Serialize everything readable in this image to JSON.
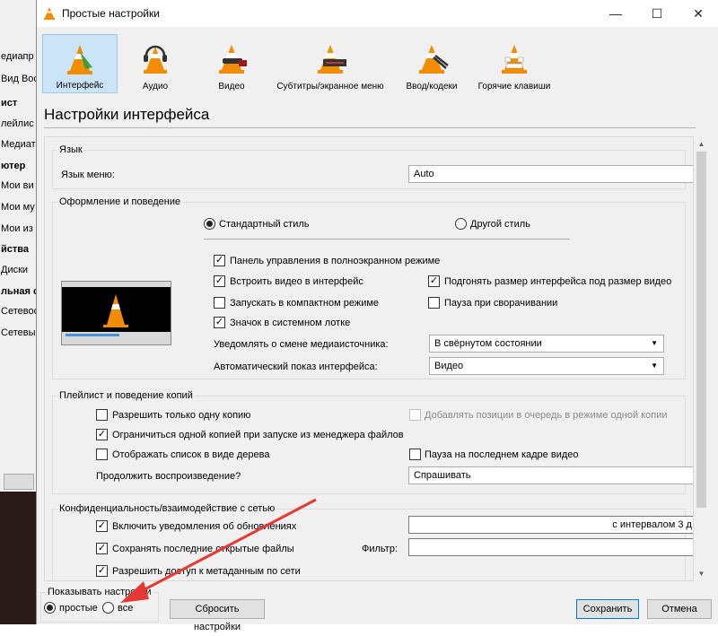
{
  "background_window": {
    "items": [
      {
        "label": "едиапр",
        "bold": false
      },
      {
        "label": "Вид  Вос",
        "bold": false
      },
      {
        "label": "ист",
        "bold": true
      },
      {
        "label": "лейлис",
        "bold": false
      },
      {
        "label": "Медиате",
        "bold": false
      },
      {
        "label": "ютер",
        "bold": true
      },
      {
        "label": "Мои ви",
        "bold": false
      },
      {
        "label": "Мои му",
        "bold": false
      },
      {
        "label": "Мои из",
        "bold": false
      },
      {
        "label": "йства",
        "bold": true
      },
      {
        "label": "Диски",
        "bold": false
      },
      {
        "label": "льная се",
        "bold": true
      },
      {
        "label": "Сетевос",
        "bold": false
      },
      {
        "label": "Сетевы",
        "bold": false
      }
    ]
  },
  "window": {
    "title": "Простые настройки",
    "minimize": "—",
    "maximize": "☐",
    "close": "✕",
    "bg_close": "✕"
  },
  "toolbar": [
    {
      "label": "Интерфейс",
      "selected": true
    },
    {
      "label": "Аудио",
      "selected": false
    },
    {
      "label": "Видео",
      "selected": false
    },
    {
      "label": "Субтитры/экранное меню",
      "selected": false
    },
    {
      "label": "Ввод/кодеки",
      "selected": false
    },
    {
      "label": "Горячие клавиши",
      "selected": false
    }
  ],
  "page_title": "Настройки интерфейса",
  "language": {
    "group": "Язык",
    "menu_label": "Язык меню:",
    "menu_value": "Auto"
  },
  "look": {
    "group": "Оформление и поведение",
    "style_native": "Стандартный стиль",
    "style_other": "Другой стиль",
    "fullscreen_controller": "Панель управления в полноэкранном режиме",
    "embed_video": "Встроить видео в интерфейс",
    "resize_interface": "Подгонять размер интерфейса под размер видео",
    "start_minimal": "Запускать в компактном режиме",
    "pause_minimized": "Пауза при сворачивании",
    "systray": "Значок в системном лотке",
    "notify_label": "Уведомлять о смене медиаисточника:",
    "notify_value": "В свёрнутом состоянии",
    "autoraise_label": "Автоматический показ интерфейса:",
    "autoraise_value": "Видео"
  },
  "playlist": {
    "group": "Плейлист и поведение копий",
    "one_instance": "Разрешить только одну копию",
    "enqueue": "Добавлять позиции в очередь в режиме одной копии",
    "file_manager": "Ограничиться одной копией при запуске из менеджера файлов",
    "tree": "Отображать список в виде дерева",
    "pause_last": "Пауза на последнем кадре видео",
    "resume_label": "Продолжить воспроизведение?",
    "resume_value": "Спрашивать"
  },
  "privacy": {
    "group": "Конфиденциальность/взаимодействие с сетью",
    "updates": "Включить уведомления об обновлениях",
    "updates_interval": "с интервалом 3 д.",
    "recent": "Сохранять последние открытые файлы",
    "filter_label": "Фильтр:",
    "metadata": "Разрешить доступ к метаданным по сети"
  },
  "show_settings": {
    "label": "Показывать настройки",
    "simple": "простые",
    "all": "все"
  },
  "buttons": {
    "reset": "Сбросить настройки",
    "save": "Сохранить",
    "cancel": "Отмена"
  },
  "colors": {
    "accent": "#0078d7",
    "arrow": "#e53935",
    "vlc_orange": "#f28c00"
  }
}
